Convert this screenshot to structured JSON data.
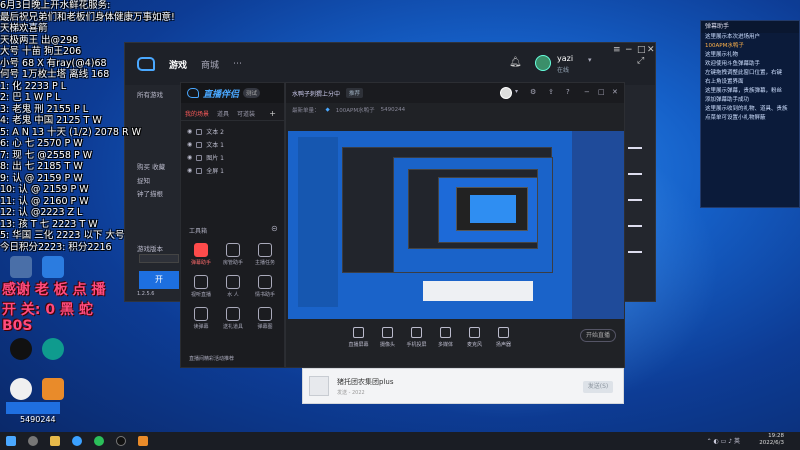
{
  "overlay_lines": [
    "6月3日晚上开水鲜花服务:",
    "最后祝兄弟们和老板们身体健康万事如意!",
    "天梯欢喜箭",
    "天极两王  出@298",
    "大号 十苗 狗王206",
    "小号 68 X 有ray(@4)68",
    "何号 1万枚士塔 离线 168",
    "1: 化 2233 P L",
    "2: 巴 1 W P L",
    "3: 老鬼 刑 2155 P L",
    "4: 老鬼 中国 2125 T W",
    "5: A  N 13 十天 (1/2) 2078 R W",
    "6: 心 七  2570 P W",
    "7: 现 七 @2558 P W",
    "8: 出 七 2185 T W",
    "9: 认 @ 2159 P W",
    "10: 认 @ 2159 P W",
    "11: 认 @ 2160 P W",
    "12: 认 @2223 Z L",
    "13: 孩 T 七 2223 T W",
    "5: 华国 三化 2223 以下 大号",
    "今日积分2223: 积分2216"
  ],
  "red_text": {
    "line1": "感谢 老 板 点 播",
    "line2": "开  关: 0 黑 蛇",
    "line3": "B0S"
  },
  "room_id": "5490244",
  "main_window": {
    "tab_game": "游戏",
    "tab_shop": "商城",
    "user_name": "yazi",
    "user_status": "在线",
    "side_items": [
      "所有游戏",
      "购买 收藏",
      "捉知",
      "钟了描根"
    ],
    "side_bottom": [
      "游戏版本",
      "版本号",
      "1.2.5.6"
    ],
    "start_label": "开"
  },
  "helper": {
    "logo_text": "直播伴侣",
    "badge": "测试",
    "tabs": [
      "我的场景",
      "道具",
      "可道装"
    ],
    "sources": [
      "文本 2",
      "文本 1",
      "图片 1",
      "全屏 1"
    ],
    "tools_label": "工具箱",
    "tools": [
      {
        "label": "弹幕助手",
        "red": true
      },
      {
        "label": "房管助手",
        "red": false
      },
      {
        "label": "主播任务",
        "red": false
      },
      {
        "label": "视听直播",
        "red": false
      },
      {
        "label": "水 人",
        "red": false
      },
      {
        "label": "情书助手",
        "red": false
      },
      {
        "label": "读弹幕",
        "red": false
      },
      {
        "label": "送礼道具",
        "red": false
      },
      {
        "label": "弹幕图",
        "red": false
      }
    ],
    "footer": "直播间精彩活动推荐"
  },
  "preview": {
    "title": "水鸭子刺猬上分中",
    "tag": "推荐",
    "meta1": "最新单量：",
    "meta2": "100APM水鸭子",
    "meta3": "5490244",
    "bottom_items": [
      "直播屏幕",
      "摄像头",
      "手机投屏",
      "多媒体",
      "麦克风",
      "扬声器"
    ],
    "start_btn": "开始直播"
  },
  "right_panel": {
    "title": "弹幕助手",
    "lines": [
      "这里展示本次进场用户",
      "100APM水鸭子",
      "这里展示礼物",
      "",
      "欢迎使用斗鱼弹幕助手",
      "左键拖拽调整此窗口位置，右键",
      "右上角设置界面",
      "这里展示弹幕，贵族弹幕，粉丝",
      "添加弹幕助手成功",
      "",
      "这里展示收到的礼物、道具、贵族",
      "点菜单可设置小礼物屏蔽"
    ]
  },
  "notification": {
    "title": "猪托团农集团plus",
    "sub": "发送 - 2022",
    "send_label": "发送(S)"
  },
  "taskbar": {
    "time": "19:28",
    "date": "2022/6/3",
    "lang": "英"
  },
  "desktop_icons": [
    "视频",
    "直播伴侣",
    "QQ",
    "电脑管家",
    "斗鱼直播"
  ]
}
